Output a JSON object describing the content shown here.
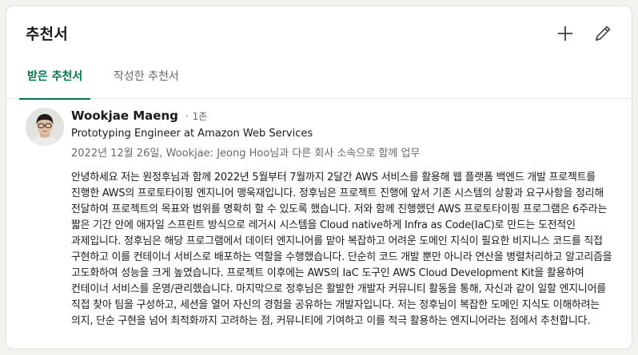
{
  "section": {
    "title": "추천서",
    "add_icon": "plus-icon",
    "edit_icon": "pencil-icon"
  },
  "tabs": [
    {
      "label": "받은 추천서",
      "active": true
    },
    {
      "label": "작성한 추천서",
      "active": false
    }
  ],
  "recommendation": {
    "name": "Wookjae Maeng",
    "separator": "·",
    "degree": "1촌",
    "headline": "Prototyping Engineer at Amazon Web Services",
    "meta": "2022년 12월 26일, Wookjae: Jeong Hoo님과 다른 회사 소속으로 함께 업무",
    "text": "안녕하세요 저는 원정후님과 함께 2022년 5월부터 7월까지 2달간 AWS 서비스를 활용해 웹 플랫폼 백엔드 개발 프로젝트를 진행한 AWS의 프로토타이핑 엔지니어 맹욱재입니다. 정후님은 프로젝트 진행에 앞서 기존 시스템의 상황과 요구사항을 정리해 전달하여 프로젝트의 목표와 범위를 명확히 할 수 있도록 했습니다. 저와 함께 진행했던 AWS 프로토타이핑 프로그램은 6주라는 짧은 기간 안에 애자일 스프린트 방식으로 레거시 시스템을 Cloud native하게 Infra as Code(IaC)로 만드는 도전적인 과제입니다. 정후님은 해당 프로그램에서 데이터 엔지니어를 맡아 복잡하고 어려운 도메인 지식이 필요한 비지니스 코드를 직접 구현하고 이를 컨테이너 서비스로 배포하는 역할을 수행했습니다. 단순히 코드 개발 뿐만 아니라 연산을 병렬처리하고 알고리즘을 고도화하여 성능을 크게 높였습니다. 프로젝트 이후에는 AWS의 IaC 도구인 AWS Cloud Development Kit을 활용하여 컨테이너 서비스를 운영/관리했습니다. 마지막으로 정후님은 활발한 개발자 커뮤니티 활동을 통해, 자신과 같이 일할 엔지니어를 직접 찾아 팀을 구성하고, 세션을 열어 자신의 경험을 공유하는 개발자입니다. 저는 정후님이 복잡한 도메인 지식도 이해하려는 의지, 단순 구현을 넘어 최적화까지 고려하는 점, 커뮤니티에 기여하고 이를 적극 활용하는 엔지니어라는 점에서 추천합니다."
  },
  "colors": {
    "accent": "#01754f",
    "muted_text": "#666666",
    "background": "#f4f2ee"
  }
}
